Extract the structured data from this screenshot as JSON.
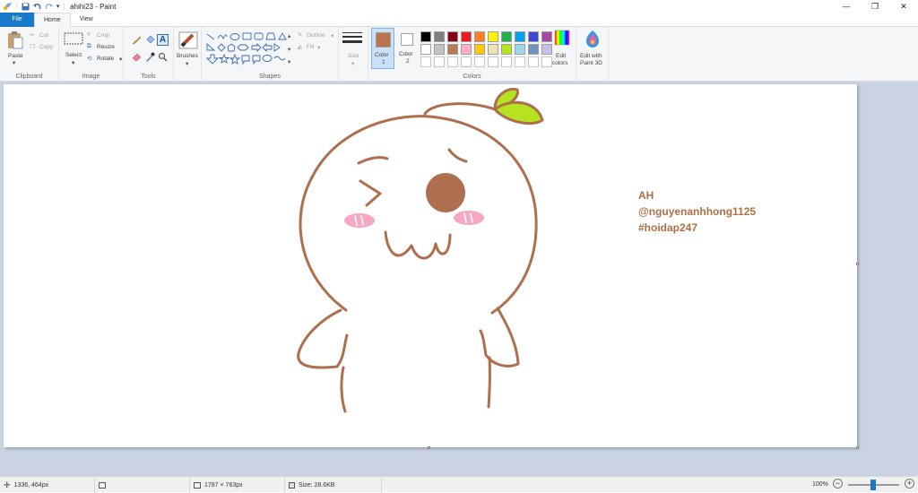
{
  "titlebar": {
    "title": "ahihi23 - Paint",
    "quick_access_dropdown": "▾",
    "minimize": "—",
    "maximize": "❐",
    "close": "✕"
  },
  "tabs": {
    "file": "File",
    "home": "Home",
    "view": "View"
  },
  "clipboard": {
    "paste": "Paste",
    "cut": "Cut",
    "copy": "Copy",
    "label": "Clipboard"
  },
  "image": {
    "select": "Select",
    "crop": "Crop",
    "resize": "Resize",
    "rotate": "Rotate",
    "label": "Image"
  },
  "tools": {
    "label": "Tools"
  },
  "brushes": {
    "label": "Brushes"
  },
  "shapes": {
    "outline": "Outline",
    "fill": "Fill",
    "label": "Shapes"
  },
  "size": {
    "label": "Size"
  },
  "colors": {
    "color1_label": "Color",
    "color1_num": "1",
    "color2_label": "Color",
    "color2_num": "2",
    "edit_colors_1": "Edit",
    "edit_colors_2": "colors",
    "edit_paint3d_1": "Edit with",
    "edit_paint3d_2": "Paint 3D",
    "label": "Colors",
    "color1": "#b8734f",
    "color2": "#ffffff",
    "palette_row1": [
      "#000000",
      "#7f7f7f",
      "#880015",
      "#ed1c24",
      "#ff7f27",
      "#fff200",
      "#22b14c",
      "#00a2e8",
      "#3f48cc",
      "#a349a4"
    ],
    "palette_row2": [
      "#ffffff",
      "#c3c3c3",
      "#b97a57",
      "#ffaec9",
      "#ffc90e",
      "#efe4b0",
      "#b5e61d",
      "#99d9ea",
      "#7092be",
      "#c8bfe7"
    ]
  },
  "canvas": {
    "text_line1": "AH",
    "text_line2": "@nguyenanhhong1125",
    "text_line3": "#hoidap247",
    "stroke_color": "#ad6f4e",
    "blush_color": "#f6a7c1",
    "leaf_color": "#b6e21f"
  },
  "status": {
    "cursor_pos": "1336, 464px",
    "canvas_size": "1787 × 763px",
    "file_size": "Size: 28.6KB",
    "zoom": "100%",
    "zoom_out": "−",
    "zoom_in": "+"
  }
}
